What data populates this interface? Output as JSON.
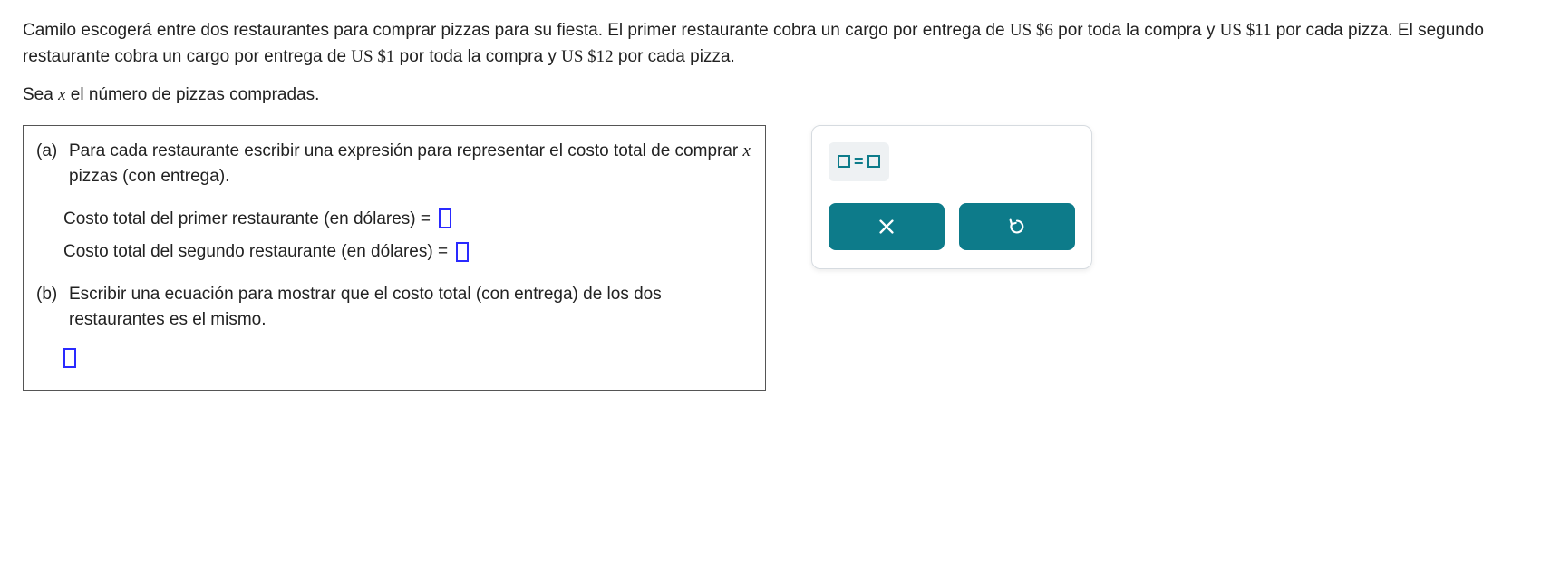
{
  "problem": {
    "s1a": "Camilo escogerá entre dos restaurantes para comprar pizzas para su fiesta. El primer restaurante cobra un cargo por entrega de ",
    "v1": "US $6",
    "s1b": " por toda la compra y ",
    "v2": "US $11",
    "s1c": " por cada pizza. El segundo restaurante cobra un cargo por entrega de ",
    "v3": "US $1",
    "s1d": " por toda la compra y ",
    "v4": "US $12",
    "s1e": " por cada pizza.",
    "s2a": "Sea ",
    "s2var": "x",
    "s2b": " el número de pizzas compradas."
  },
  "partA": {
    "label": "(a) ",
    "text1": "Para cada restaurante escribir una expresión para representar el costo total de comprar ",
    "var": "x",
    "text2": " pizzas (con entrega).",
    "line1": "Costo total del primer restaurante (en dólares) = ",
    "line2": "Costo total del segundo restaurante (en dólares) = "
  },
  "partB": {
    "label": "(b) ",
    "text": "Escribir una ecuación para mostrar que el costo total (con entrega) de los dos restaurantes es el mismo."
  },
  "keypad": {
    "eq": "="
  }
}
